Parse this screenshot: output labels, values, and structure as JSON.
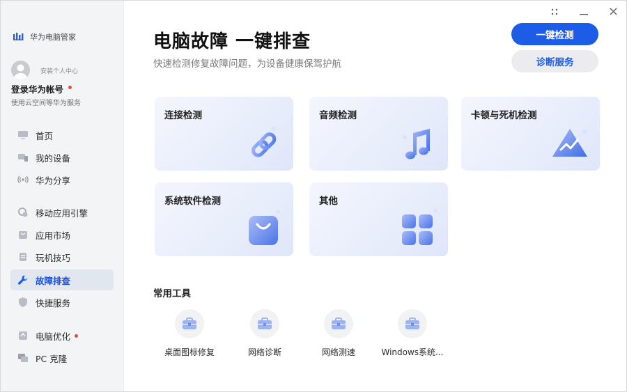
{
  "app": {
    "brand_name": "华为电脑管家"
  },
  "account": {
    "security_center": "安装个人中心",
    "login_label": "登录华为帐号",
    "login_sub": "使用云空间等华为服务"
  },
  "sidebar": {
    "items": [
      {
        "label": "首页",
        "icon": "monitor-icon"
      },
      {
        "label": "我的设备",
        "icon": "devices-icon"
      },
      {
        "label": "华为分享",
        "icon": "share-wireless-icon"
      },
      {
        "label": "移动应用引擎",
        "icon": "app-engine-icon"
      },
      {
        "label": "应用市场",
        "icon": "store-bag-icon"
      },
      {
        "label": "玩机技巧",
        "icon": "tips-icon"
      },
      {
        "label": "故障排查",
        "icon": "wrench-icon"
      },
      {
        "label": "快捷服务",
        "icon": "shield-icon"
      },
      {
        "label": "电脑优化",
        "icon": "optimize-icon"
      },
      {
        "label": "PC 克隆",
        "icon": "pc-clone-icon"
      }
    ]
  },
  "header": {
    "title": "电脑故障 一键排查",
    "subtitle": "快速检测修复故障问题，为设备健康保驾护航",
    "primary_button": "一键检测",
    "secondary_button": "诊断服务"
  },
  "cards": [
    {
      "label": "连接检测",
      "icon": "link-icon"
    },
    {
      "label": "音频检测",
      "icon": "music-note-icon"
    },
    {
      "label": "卡顿与死机检测",
      "icon": "triangle-chart-icon"
    },
    {
      "label": "系统软件检测",
      "icon": "bag-icon"
    },
    {
      "label": "其他",
      "icon": "grid-icon"
    }
  ],
  "tools": {
    "title": "常用工具",
    "items": [
      {
        "label": "桌面图标修复",
        "icon": "toolbox-icon"
      },
      {
        "label": "网络诊断",
        "icon": "toolbox-icon"
      },
      {
        "label": "网络测速",
        "icon": "toolbox-icon"
      },
      {
        "label": "Windows系统...",
        "icon": "toolbox-icon"
      }
    ]
  },
  "colors": {
    "accent": "#1c5ce6",
    "active_bg": "#e1e6ef",
    "badge": "#e84c3d"
  }
}
